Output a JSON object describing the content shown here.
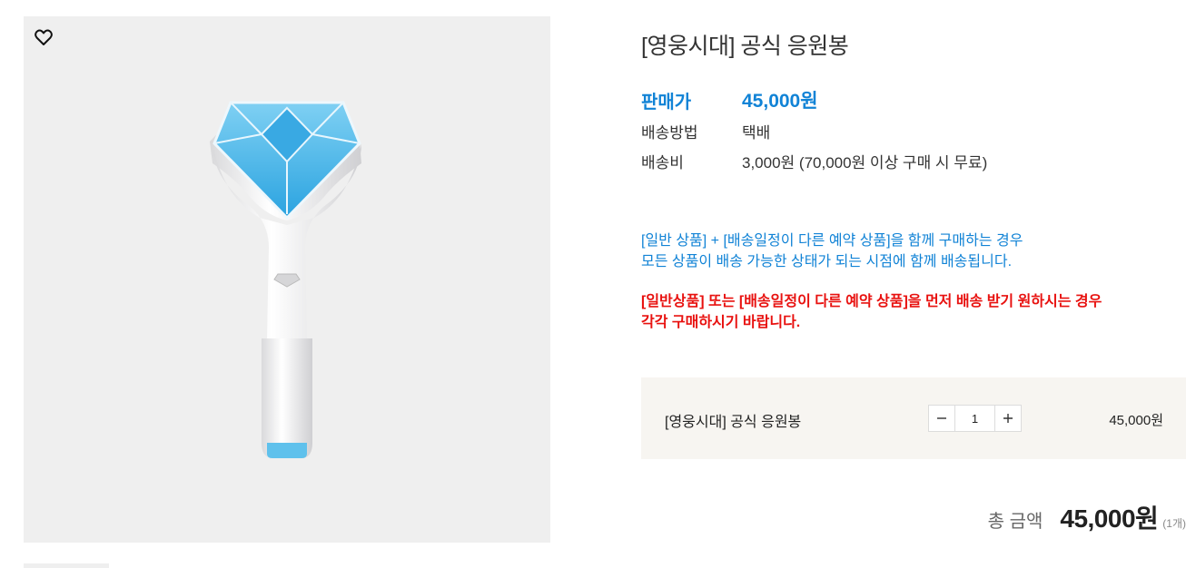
{
  "product": {
    "title": "[영웅시대] 공식 응원봉",
    "wish_icon": "heart-outline-icon",
    "image_alt": "영웅시대 공식 응원봉"
  },
  "info": {
    "price_label": "판매가",
    "price_value": "45,000원",
    "shipping_label": "배송방법",
    "shipping_value": "택배",
    "fee_label": "배송비",
    "fee_value": "3,000원 (70,000원 이상 구매 시 무료)"
  },
  "notice": {
    "blue_line1": "[일반 상품] + [배송일정이 다른 예약 상품]을 함께 구매하는 경우",
    "blue_line2": "모든 상품이 배송 가능한 상태가 되는 시점에 함께 배송됩니다.",
    "red_line1": "[일반상품] 또는 [배송일정이 다른 예약 상품]을 먼저 배송 받기 원하시는 경우",
    "red_line2": "각각 구매하시기 바랍니다."
  },
  "option": {
    "name": "[영웅시대] 공식 응원봉",
    "quantity": "1",
    "price": "45,000원",
    "minus_icon": "minus-icon",
    "plus_icon": "plus-icon"
  },
  "total": {
    "label": "총 금액",
    "value": "45,000원",
    "count": "(1개)"
  },
  "colors": {
    "accent": "#1183d6",
    "warning": "#e8110f",
    "option_bg": "#f7f5f1",
    "image_bg": "#efefef"
  }
}
